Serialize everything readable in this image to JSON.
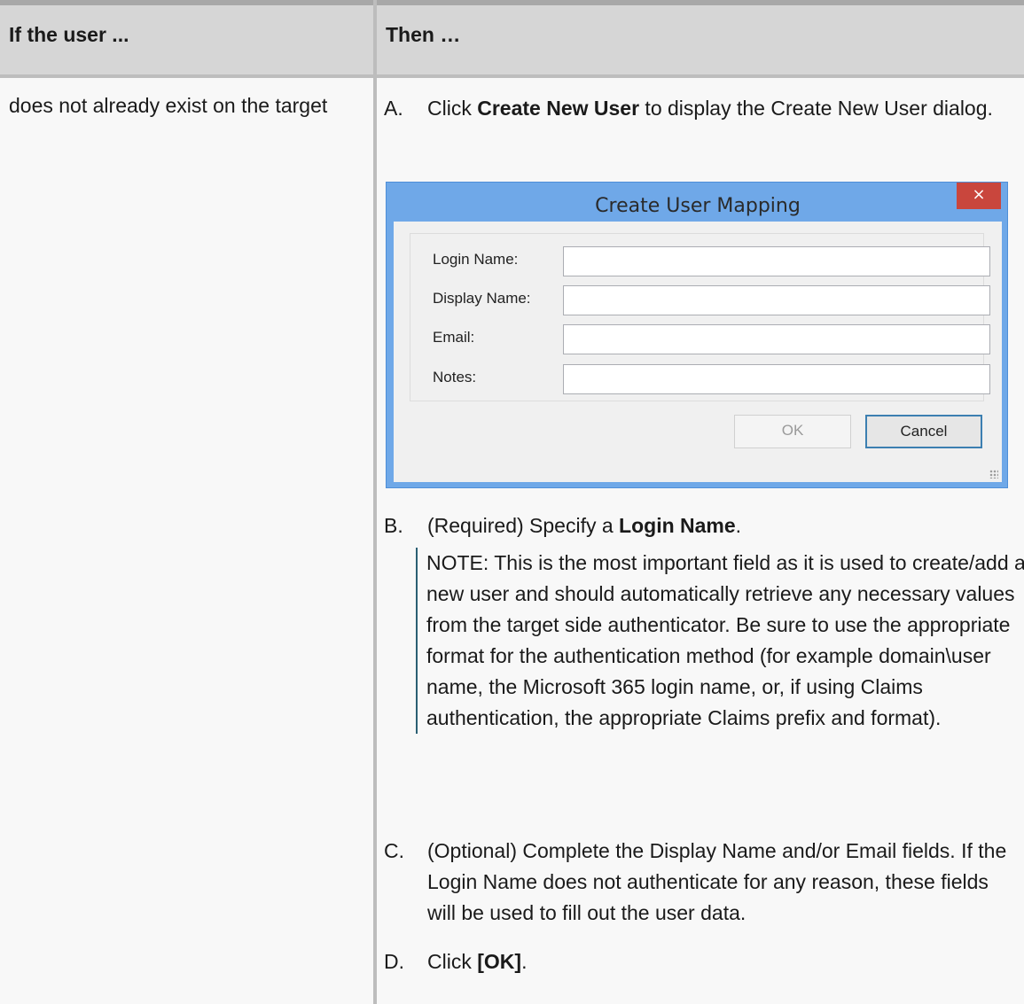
{
  "table": {
    "header_col1": "If the user ...",
    "header_col2": "Then …",
    "condition": "does not already exist on the target"
  },
  "steps": {
    "a_letter": "A.",
    "a_pre": "Click ",
    "a_bold": "Create New User",
    "a_post": " to display the Create New User dialog.",
    "b_letter": "B.",
    "b_pre": "(Required) Specify a ",
    "b_bold": "Login Name",
    "b_post": ".",
    "c_letter": "C.",
    "c_text": "(Optional) Complete the Display Name and/or Email fields. If the Login Name does not authenticate for any reason, these fields will be used to fill out the user data.",
    "d_letter": "D.",
    "d_pre": "Click ",
    "d_bold": "[OK]",
    "d_post": "."
  },
  "note": "NOTE: This is the most important field as it is used to create/add a new user and should automatically retrieve any necessary values from the target side authenticator. Be sure to use the appropriate format for the authentication method (for example domain\\user name, the Microsoft 365 login name, or, if using Claims authentication, the appropriate Claims prefix and format).",
  "dialog": {
    "title": "Create User Mapping",
    "close_glyph": "×",
    "fields": [
      {
        "label": "Login Name:",
        "value": ""
      },
      {
        "label": "Display Name:",
        "value": ""
      },
      {
        "label": "Email:",
        "value": ""
      },
      {
        "label": "Notes:",
        "value": ""
      }
    ],
    "ok_label": "OK",
    "cancel_label": "Cancel"
  },
  "colors": {
    "header_bg": "#d6d6d6",
    "dialog_frame": "#6fa8e8",
    "close_button": "#c9463d",
    "note_rule": "#2b5f73"
  }
}
